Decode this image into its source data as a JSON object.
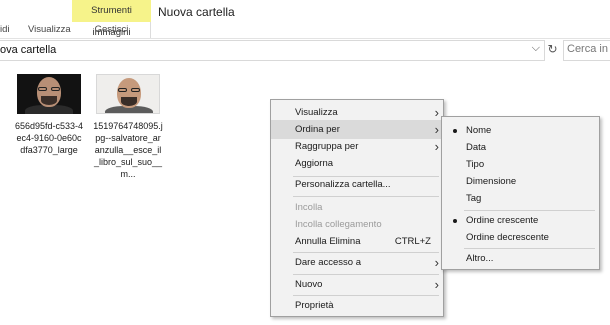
{
  "ribbon": {
    "tabs": [
      {
        "label": "idi"
      },
      {
        "label": "Visualizza"
      }
    ],
    "tools_group": {
      "title": "Strumenti immagini",
      "subtab": "Gestisci",
      "highlight_color": "#f6f38a"
    },
    "window_title": "Nuova cartella"
  },
  "address_bar": {
    "path": "ova cartella",
    "chevron": "⌵"
  },
  "search": {
    "placeholder": "Cerca in N"
  },
  "files": [
    {
      "name": "656d95fd-c533-4ec4-9160-0e60cdfa3770_large"
    },
    {
      "name": "1519764748095.jpg--salvatore_aranzulla__esce_il_libro_sul_suo__m..."
    }
  ],
  "context_menu": {
    "items": [
      {
        "label": "Visualizza",
        "submenu": true
      },
      {
        "label": "Ordina per",
        "submenu": true
      },
      {
        "label": "Raggruppa per",
        "submenu": true
      },
      {
        "label": "Aggiorna"
      },
      {
        "label": "Personalizza cartella..."
      },
      {
        "label": "Incolla"
      },
      {
        "label": "Incolla collegamento"
      },
      {
        "label": "Annulla Elimina",
        "shortcut": "CTRL+Z"
      },
      {
        "label": "Dare accesso a",
        "submenu": true
      },
      {
        "label": "Nuovo",
        "submenu": true
      },
      {
        "label": "Proprietà"
      }
    ]
  },
  "sort_submenu": {
    "items": [
      {
        "label": "Nome",
        "selected": true
      },
      {
        "label": "Data"
      },
      {
        "label": "Tipo"
      },
      {
        "label": "Dimensione"
      },
      {
        "label": "Tag"
      },
      {
        "label": "Ordine crescente",
        "selected": true
      },
      {
        "label": "Ordine decrescente"
      },
      {
        "label": "Altro..."
      }
    ]
  }
}
